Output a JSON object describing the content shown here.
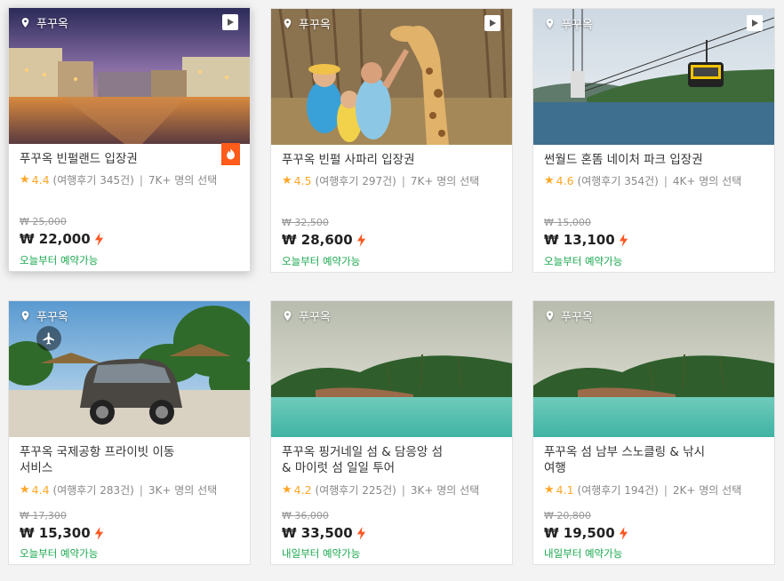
{
  "cards": [
    {
      "location": "푸꾸옥",
      "title": "푸꾸옥 빈펄랜드 입장권",
      "rating": "4.4",
      "reviews": "(여행후기 345건)",
      "chosen": "7K+ 명의 선택",
      "original_price": "₩ 25,000",
      "price": "₩ 22,000",
      "availability": "오늘부터 예약가능",
      "icons": [
        "location-pin-icon",
        "video-play-icon",
        "hot-flame-icon",
        "lightning-icon"
      ]
    },
    {
      "location": "푸꾸옥",
      "title": "푸꾸옥 빈펄 사파리 입장권",
      "rating": "4.5",
      "reviews": "(여행후기 297건)",
      "chosen": "7K+ 명의 선택",
      "original_price": "₩ 32,500",
      "price": "₩ 28,600",
      "availability": "오늘부터 예약가능",
      "icons": [
        "location-pin-icon",
        "video-play-icon",
        "lightning-icon"
      ]
    },
    {
      "location": "푸꾸옥",
      "title": "썬월드 혼똠 네이처 파크 입장권",
      "rating": "4.6",
      "reviews": "(여행후기 354건)",
      "chosen": "4K+ 명의 선택",
      "original_price": "₩ 15,000",
      "price": "₩ 13,100",
      "availability": "오늘부터 예약가능",
      "icons": [
        "location-pin-icon",
        "video-play-icon",
        "lightning-icon"
      ]
    },
    {
      "location": "푸꾸옥",
      "title_line1": "푸꾸옥 국제공항 프라이빗 이동",
      "title_line2": "서비스",
      "rating": "4.4",
      "reviews": "(여행후기 283건)",
      "chosen": "3K+ 명의 선택",
      "original_price": "₩ 17,300",
      "price": "₩ 15,300",
      "availability": "오늘부터 예약가능",
      "icons": [
        "location-pin-icon",
        "airplane-icon",
        "lightning-icon"
      ]
    },
    {
      "location": "푸꾸옥",
      "title_line1": "푸꾸옥 핑거네일 섬 & 담응앙 섬",
      "title_line2": "& 마이럿 섬 일일 투어",
      "rating": "4.2",
      "reviews": "(여행후기 225건)",
      "chosen": "3K+ 명의 선택",
      "original_price": "₩ 36,000",
      "price": "₩ 33,500",
      "availability": "내일부터 예약가능",
      "icons": [
        "location-pin-icon",
        "lightning-icon"
      ]
    },
    {
      "location": "푸꾸옥",
      "title_line1": "푸꾸옥 섬 남부 스노클링 & 낚시",
      "title_line2": "여행",
      "rating": "4.1",
      "reviews": "(여행후기 194건)",
      "chosen": "2K+ 명의 선택",
      "original_price": "₩ 20,800",
      "price": "₩ 19,500",
      "availability": "내일부터 예약가능",
      "icons": [
        "location-pin-icon",
        "lightning-icon"
      ]
    }
  ],
  "colors": {
    "accent_star": "#ffa628",
    "availability": "#1aa84f",
    "hot_badge": "#ff5b1a",
    "lightning": "#ff5722"
  }
}
